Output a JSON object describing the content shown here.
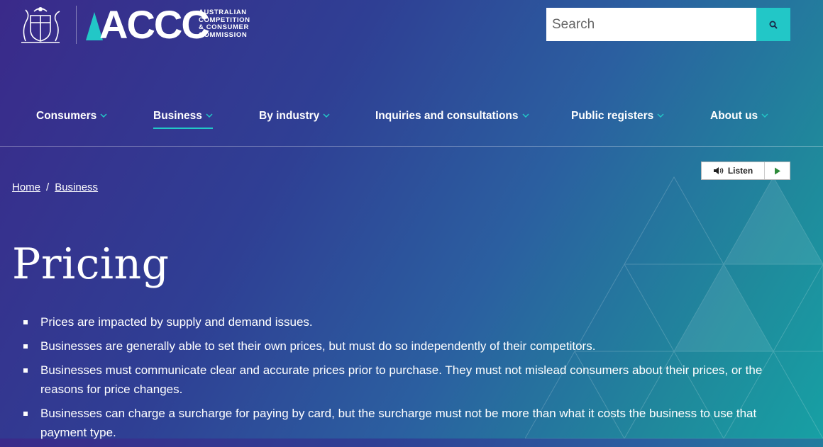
{
  "header": {
    "logo_acronym": "ACCC",
    "logo_subtitle": [
      "AUSTRALIAN",
      "COMPETITION",
      "& CONSUMER",
      "COMMISSION"
    ],
    "search_placeholder": "Search"
  },
  "nav": {
    "items": [
      {
        "label": "Consumers"
      },
      {
        "label": "Business",
        "active": true
      },
      {
        "label": "By industry"
      },
      {
        "label": "Inquiries and consultations"
      },
      {
        "label": "Public registers"
      },
      {
        "label": "About us"
      }
    ]
  },
  "listen": {
    "label": "Listen"
  },
  "breadcrumb": {
    "home": "Home",
    "separator": "/",
    "current": "Business"
  },
  "page": {
    "title": "Pricing",
    "points": [
      "Prices are impacted by supply and demand issues.",
      "Businesses are generally able to set their own prices, but must do so independently of their competitors.",
      "Businesses must communicate clear and accurate prices prior to purchase. They must not mislead consumers about their prices, or the reasons for price changes.",
      "Businesses can charge a surcharge for paying by card, but the surcharge must not be more than what it costs the business to use that payment type."
    ]
  },
  "colors": {
    "accent": "#22c7c7",
    "bg_start": "#3a2a8a",
    "bg_end": "#17a0a4"
  }
}
